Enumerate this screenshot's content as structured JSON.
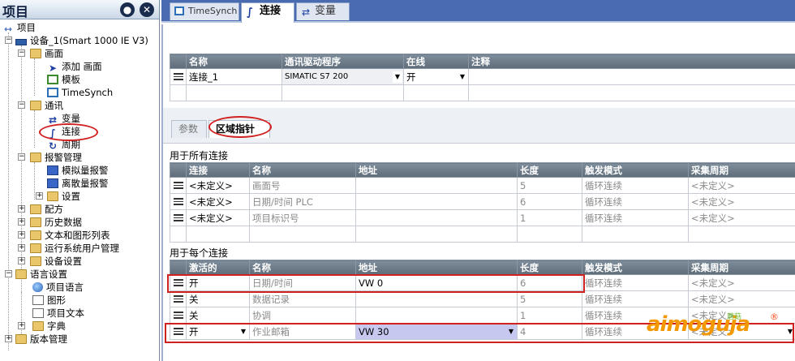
{
  "panel": {
    "title": "项目",
    "pin_icon": "pin-icon",
    "close_icon": "close-icon"
  },
  "tree": [
    {
      "label": "项目",
      "icon": "project-icon"
    },
    {
      "label": "设备_1(Smart 1000 IE V3)",
      "icon": "device-icon"
    },
    {
      "label": "画面",
      "icon": "folder-icon"
    },
    {
      "label": "添加 画面",
      "icon": "add-icon"
    },
    {
      "label": "模板",
      "icon": "template-icon"
    },
    {
      "label": "TimeSynch",
      "icon": "screen-icon"
    },
    {
      "label": "通讯",
      "icon": "folder-icon"
    },
    {
      "label": "变量",
      "icon": "variable-icon"
    },
    {
      "label": "连接",
      "icon": "connection-icon"
    },
    {
      "label": "周期",
      "icon": "cycle-icon"
    },
    {
      "label": "报警管理",
      "icon": "folder-icon"
    },
    {
      "label": "模拟量报警",
      "icon": "alarm-icon"
    },
    {
      "label": "离散量报警",
      "icon": "alarm-icon"
    },
    {
      "label": "设置",
      "icon": "folder-icon"
    },
    {
      "label": "配方",
      "icon": "folder-icon"
    },
    {
      "label": "历史数据",
      "icon": "folder-icon"
    },
    {
      "label": "文本和图形列表",
      "icon": "folder-icon"
    },
    {
      "label": "运行系统用户管理",
      "icon": "folder-icon"
    },
    {
      "label": "设备设置",
      "icon": "folder-icon"
    },
    {
      "label": "语言设置",
      "icon": "folder-icon"
    },
    {
      "label": "项目语言",
      "icon": "globe-icon"
    },
    {
      "label": "图形",
      "icon": "graphic-icon"
    },
    {
      "label": "项目文本",
      "icon": "text-icon"
    },
    {
      "label": "字典",
      "icon": "folder-icon"
    },
    {
      "label": "版本管理",
      "icon": "folder-icon"
    }
  ],
  "tabs": [
    {
      "label": "TimeSynch",
      "icon": "screen-icon"
    },
    {
      "label": "连接",
      "icon": "connection-icon"
    },
    {
      "label": "变量",
      "icon": "variable-icon"
    }
  ],
  "connections": {
    "headers": [
      "名称",
      "通讯驱动程序",
      "在线",
      "注释"
    ],
    "rows": [
      [
        "连接_1",
        "SIMATIC S7 200",
        "开",
        ""
      ]
    ]
  },
  "subtabs": [
    "参数",
    "区域指针"
  ],
  "all_conn": {
    "title": "用于所有连接",
    "headers": [
      "连接",
      "名称",
      "地址",
      "长度",
      "触发模式",
      "采集周期"
    ],
    "rows": [
      [
        "<未定义>",
        "画面号",
        "",
        "5",
        "循环连续",
        "<未定义>"
      ],
      [
        "<未定义>",
        "日期/时间 PLC",
        "",
        "6",
        "循环连续",
        "<未定义>"
      ],
      [
        "<未定义>",
        "项目标识号",
        "",
        "1",
        "循环连续",
        "<未定义>"
      ]
    ]
  },
  "each_conn": {
    "title": "用于每个连接",
    "headers": [
      "激活的",
      "名称",
      "地址",
      "长度",
      "触发模式",
      "采集周期"
    ],
    "rows": [
      [
        "开",
        "日期/时间",
        "VW 0",
        "6",
        "循环连续",
        "<未定义>"
      ],
      [
        "关",
        "数据记录",
        "",
        "5",
        "循环连续",
        "<未定义>"
      ],
      [
        "关",
        "协调",
        "",
        "1",
        "循环连续",
        "<未定义>"
      ],
      [
        "开",
        "作业邮箱",
        "VW 30",
        "4",
        "循环连续",
        "<未定义>"
      ]
    ]
  },
  "watermark": {
    "main": "aimoguja",
    "sub": "蘑菇",
    "reg": "®"
  }
}
